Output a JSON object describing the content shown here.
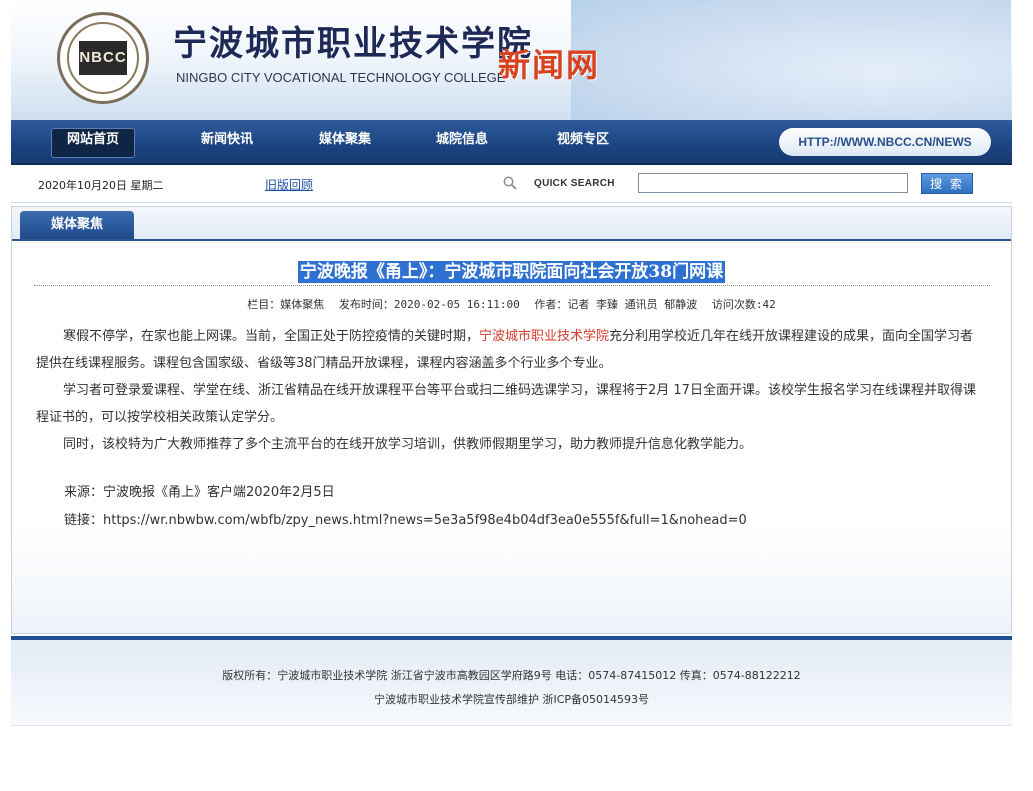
{
  "header": {
    "logo_text": "NBCC",
    "school_cn": "宁波城市职业技术学院",
    "school_en": "NINGBO CITY VOCATIONAL TECHNOLOGY COLLEGE",
    "site_name": "新闻网"
  },
  "nav": {
    "items": [
      {
        "label": "网站首页",
        "active": true
      },
      {
        "label": "新闻快讯",
        "active": false
      },
      {
        "label": "媒体聚集",
        "active": false
      },
      {
        "label": "城院信息",
        "active": false
      },
      {
        "label": "视频专区",
        "active": false
      }
    ],
    "url": "HTTP://WWW.NBCC.CN/NEWS"
  },
  "infobar": {
    "date": "2020年10月20日  星期二",
    "old_link": "旧版回顾",
    "search_label": "QUICK SEARCH",
    "search_value": "",
    "search_button": "搜 索"
  },
  "panel": {
    "tab": "媒体聚焦"
  },
  "article": {
    "title": "宁波晚报《甬上》：宁波城市职院面向社会开放38门网课",
    "meta": {
      "column": "栏目：媒体聚焦",
      "published": "发布时间：2020-02-05 16:11:00",
      "author": "作者：记者 李臻 通讯员 郁静波",
      "views": "访问次数:42"
    },
    "p1_before": "寒假不停学，在家也能上网课。当前，全国正处于防控疫情的关键时期，",
    "p1_highlight": "宁波城市职业技术学院",
    "p1_after": "充分利用学校近几年在线开放课程建设的成果，面向全国学习者提供在线课程服务。课程包含国家级、省级等38门精品开放课程，课程内容涵盖多个行业多个专业。",
    "p2": "学习者可登录爱课程、学堂在线、浙江省精品在线开放课程平台等平台或扫二维码选课学习，课程将于2月 17日全面开课。该校学生报名学习在线课程并取得课程证书的，可以按学校相关政策认定学分。",
    "p3": "同时，该校特为广大教师推荐了多个主流平台的在线开放学习培训，供教师假期里学习，助力教师提升信息化教学能力。",
    "source": "来源：宁波晚报《甬上》客户端2020年2月5日",
    "link": "链接：https://wr.nbwbw.com/wbfb/zpy_news.html?news=5e3a5f98e4b04df3ea0e555f&full=1&nohead=0"
  },
  "footer": {
    "line1": "版权所有：宁波城市职业技术学院 浙江省宁波市高教园区学府路9号 电话：0574-87415012 传真：0574-88122212",
    "line2": "宁波城市职业技术学院宣传部维护 浙ICP备05014593号"
  },
  "colors": {
    "nav_bg": "#1d4583",
    "highlight_red": "#d63a2a",
    "title_bg": "#2e71d0",
    "site_name": "#d8421e"
  },
  "icons": [
    "search-icon"
  ]
}
